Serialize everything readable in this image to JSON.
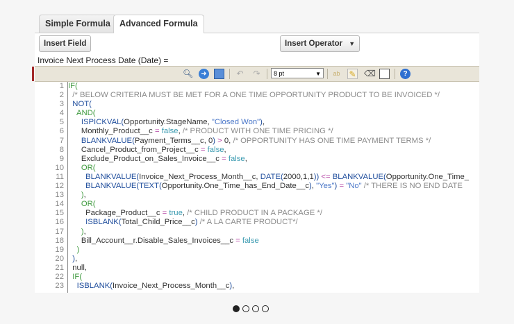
{
  "tabs": [
    {
      "label": "Simple Formula"
    },
    {
      "label": "Advanced Formula"
    }
  ],
  "buttons": {
    "insert_field": "Insert Field",
    "insert_operator": "Insert Operator",
    "operator_arrow": "▼"
  },
  "formula_label": "Invoice Next Process Date (Date) =",
  "toolbar": {
    "font_size": "8 pt",
    "font_arrow": "▼"
  },
  "code": {
    "lines": [
      {
        "n": "1",
        "tokens": [
          [
            "k",
            "IF("
          ]
        ]
      },
      {
        "n": "2",
        "tokens": [
          [
            "c",
            "  /* BELOW CRITERIA MUST BE MET FOR A ONE TIME OPPORTUNITY PRODUCT TO BE INVOICED */"
          ]
        ]
      },
      {
        "n": "3",
        "tokens": [
          [
            "p",
            "  "
          ],
          [
            "f",
            "NOT("
          ]
        ]
      },
      {
        "n": "4",
        "tokens": [
          [
            "p",
            "    "
          ],
          [
            "k",
            "AND("
          ]
        ]
      },
      {
        "n": "5",
        "tokens": [
          [
            "p",
            "      "
          ],
          [
            "f",
            "ISPICKVAL("
          ],
          [
            "p",
            "Opportunity.StageName, "
          ],
          [
            "s",
            "\"Closed Won\""
          ],
          [
            "f",
            ")"
          ],
          [
            "p",
            ","
          ]
        ]
      },
      {
        "n": "6",
        "tokens": [
          [
            "p",
            "      Monthly_Product__c "
          ],
          [
            "o",
            "="
          ],
          [
            "p",
            " "
          ],
          [
            "b",
            "false"
          ],
          [
            "p",
            ", "
          ],
          [
            "c",
            "/* PRODUCT WITH ONE TIME PRICING */"
          ]
        ]
      },
      {
        "n": "7",
        "tokens": [
          [
            "p",
            "      "
          ],
          [
            "f",
            "BLANKVALUE("
          ],
          [
            "p",
            "Payment_Terms__c, 0"
          ],
          [
            "f",
            ")"
          ],
          [
            "p",
            " "
          ],
          [
            "o",
            ">"
          ],
          [
            "p",
            " 0, "
          ],
          [
            "c",
            "/* OPPORTUNITY HAS ONE TIME PAYMENT TERMS */"
          ]
        ]
      },
      {
        "n": "8",
        "tokens": [
          [
            "p",
            "      Cancel_Product_from_Project__c "
          ],
          [
            "o",
            "="
          ],
          [
            "p",
            " "
          ],
          [
            "b",
            "false"
          ],
          [
            "p",
            ","
          ]
        ]
      },
      {
        "n": "9",
        "tokens": [
          [
            "p",
            "      Exclude_Product_on_Sales_Invoice__c "
          ],
          [
            "o",
            "="
          ],
          [
            "p",
            " "
          ],
          [
            "b",
            "false"
          ],
          [
            "p",
            ","
          ]
        ]
      },
      {
        "n": "10",
        "tokens": [
          [
            "p",
            "      "
          ],
          [
            "k",
            "OR("
          ]
        ]
      },
      {
        "n": "11",
        "tokens": [
          [
            "p",
            "        "
          ],
          [
            "f",
            "BLANKVALUE("
          ],
          [
            "p",
            "Invoice_Next_Process_Month__c, "
          ],
          [
            "f",
            "DATE("
          ],
          [
            "p",
            "2000,1,1"
          ],
          [
            "f",
            "))"
          ],
          [
            "p",
            " "
          ],
          [
            "o",
            "<="
          ],
          [
            "p",
            " "
          ],
          [
            "f",
            "BLANKVALUE("
          ],
          [
            "p",
            "Opportunity.One_Time_"
          ]
        ]
      },
      {
        "n": "12",
        "tokens": [
          [
            "p",
            "        "
          ],
          [
            "f",
            "BLANKVALUE(TEXT("
          ],
          [
            "p",
            "Opportunity.One_Time_has_End_Date__c"
          ],
          [
            "f",
            ")"
          ],
          [
            "p",
            ", "
          ],
          [
            "s",
            "\"Yes\""
          ],
          [
            "f",
            ")"
          ],
          [
            "p",
            " "
          ],
          [
            "o",
            "="
          ],
          [
            "p",
            " "
          ],
          [
            "s",
            "\"No\""
          ],
          [
            "p",
            " "
          ],
          [
            "c",
            "/* THERE IS NO END DATE"
          ]
        ]
      },
      {
        "n": "13",
        "tokens": [
          [
            "p",
            "      "
          ],
          [
            "k",
            ")"
          ],
          [
            "p",
            ","
          ]
        ]
      },
      {
        "n": "14",
        "tokens": [
          [
            "p",
            "      "
          ],
          [
            "k",
            "OR("
          ]
        ]
      },
      {
        "n": "15",
        "tokens": [
          [
            "p",
            "        Package_Product__c "
          ],
          [
            "o",
            "="
          ],
          [
            "p",
            " "
          ],
          [
            "b",
            "true"
          ],
          [
            "p",
            ", "
          ],
          [
            "c",
            "/* CHILD PRODUCT IN A PACKAGE */"
          ]
        ]
      },
      {
        "n": "16",
        "tokens": [
          [
            "p",
            "        "
          ],
          [
            "f",
            "ISBLANK("
          ],
          [
            "p",
            "Total_Child_Price__c"
          ],
          [
            "f",
            ")"
          ],
          [
            "p",
            " "
          ],
          [
            "c",
            "/* A LA CARTE PRODUCT*/"
          ]
        ]
      },
      {
        "n": "17",
        "tokens": [
          [
            "p",
            "      "
          ],
          [
            "k",
            ")"
          ],
          [
            "p",
            ","
          ]
        ]
      },
      {
        "n": "18",
        "tokens": [
          [
            "p",
            "      Bill_Account__r.Disable_Sales_Invoices__c "
          ],
          [
            "o",
            "="
          ],
          [
            "p",
            " "
          ],
          [
            "b",
            "false"
          ]
        ]
      },
      {
        "n": "19",
        "tokens": [
          [
            "p",
            "    "
          ],
          [
            "k",
            ")"
          ]
        ]
      },
      {
        "n": "20",
        "tokens": [
          [
            "p",
            "  "
          ],
          [
            "f",
            ")"
          ],
          [
            "p",
            ","
          ]
        ]
      },
      {
        "n": "21",
        "tokens": [
          [
            "p",
            "  null,"
          ]
        ]
      },
      {
        "n": "22",
        "tokens": [
          [
            "p",
            "  "
          ],
          [
            "k",
            "IF("
          ]
        ]
      },
      {
        "n": "23",
        "tokens": [
          [
            "p",
            "    "
          ],
          [
            "f",
            "ISBLANK("
          ],
          [
            "p",
            "Invoice_Next_Process_Month__c"
          ],
          [
            "f",
            ")"
          ],
          [
            "p",
            ","
          ]
        ]
      }
    ]
  },
  "pagination": {
    "pages": 4,
    "current": 1
  }
}
